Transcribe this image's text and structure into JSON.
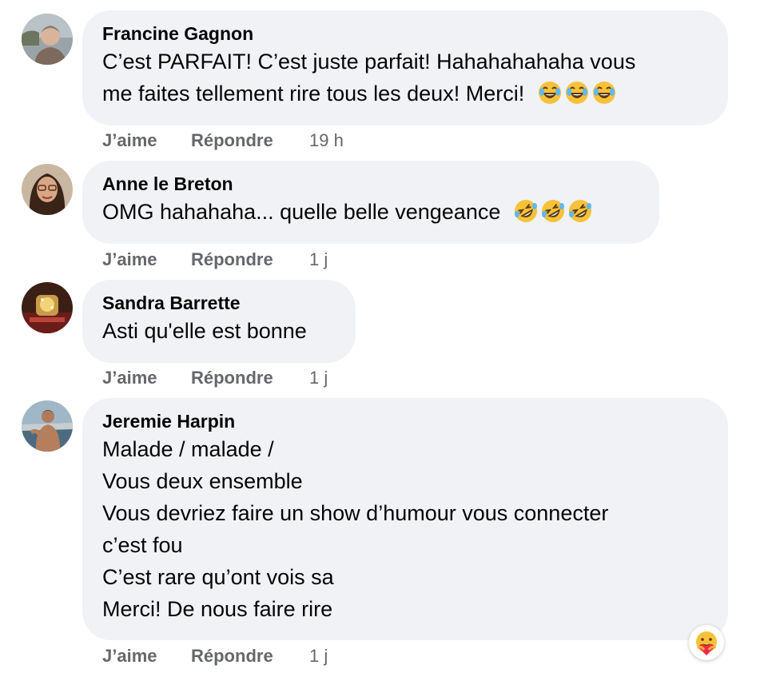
{
  "comments": [
    {
      "author": "Francine Gagnon",
      "lines": [
        "C’est PARFAIT! C’est juste parfait! Hahahahahaha vous",
        "me faites tellement rire tous les deux! Merci!"
      ],
      "emoji": "tears-of-joy-emoji x3",
      "like": "J’aime",
      "reply": "Répondre",
      "time": "19 h"
    },
    {
      "author": "Anne le Breton",
      "lines": [
        "OMG hahahaha... quelle belle vengeance"
      ],
      "emoji": "rolling-on-floor-laughing-emoji x3",
      "like": "J’aime",
      "reply": "Répondre",
      "time": "1 j"
    },
    {
      "author": "Sandra Barrette",
      "lines": [
        "Asti qu'elle est bonne"
      ],
      "like": "J’aime",
      "reply": "Répondre",
      "time": "1 j"
    },
    {
      "author": "Jeremie Harpin",
      "lines": [
        "Malade / malade /",
        "Vous deux ensemble",
        "Vous devriez faire un show d’humour vous connecter",
        "c’est fou",
        "C’est rare qu’ont vois sa",
        "Merci! De nous faire rire"
      ],
      "like": "J’aime",
      "reply": "Répondre",
      "time": "1 j",
      "reaction": "care-reaction-icon"
    }
  ],
  "colors": {
    "bubble": "#f0f2f5",
    "text": "#050505",
    "meta": "#65676b"
  }
}
